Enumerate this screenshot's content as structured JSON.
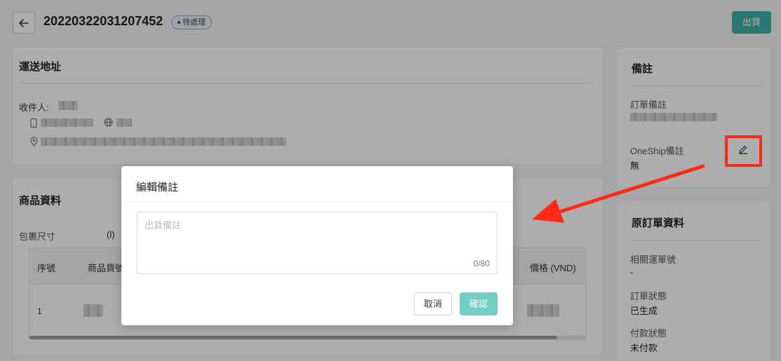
{
  "header": {
    "order_number": "20220322031207452",
    "status": "待處理",
    "ship_button": "出貨"
  },
  "shipping_address": {
    "title": "運送地址",
    "recipient_label": "收件人:"
  },
  "products": {
    "title": "商品資料",
    "package_size_label": "包裹尺寸",
    "package_size_value": "(l)",
    "columns": [
      "序號",
      "商品貨號",
      "價格 (VND)"
    ],
    "rows": [
      {
        "index": "1"
      }
    ]
  },
  "remarks": {
    "title": "備註",
    "order_remark_label": "訂單備註",
    "oneship_remark_label": "OneShip備註",
    "oneship_remark_value": "無"
  },
  "original_order": {
    "title": "原訂單資料",
    "related_tracking_label": "相關運單號",
    "related_tracking_value": "-",
    "order_status_label": "訂單狀態",
    "order_status_value": "已生成",
    "payment_status_label": "付款狀態",
    "payment_status_value": "未付款"
  },
  "modal": {
    "title": "編輯備註",
    "placeholder": "出貨備註",
    "value": "",
    "counter": "0/80",
    "cancel": "取消",
    "confirm": "確認"
  },
  "icons": {
    "back": "arrow-left-icon",
    "phone": "phone-icon",
    "globe": "globe-icon",
    "location": "location-pin-icon",
    "edit": "pencil-icon"
  },
  "colors": {
    "primary": "#3fb1a5",
    "primary_disabled": "#72cdc4",
    "annotation": "#ff2a1a"
  }
}
